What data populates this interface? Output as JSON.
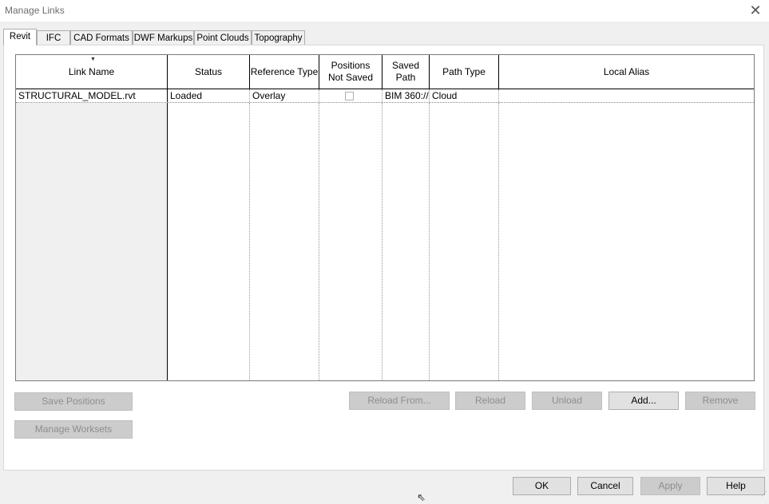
{
  "window": {
    "title": "Manage Links"
  },
  "tabs": [
    {
      "label": "Revit",
      "active": true
    },
    {
      "label": "IFC",
      "active": false
    },
    {
      "label": "CAD Formats",
      "active": false
    },
    {
      "label": "DWF Markups",
      "active": false
    },
    {
      "label": "Point Clouds",
      "active": false
    },
    {
      "label": "Topography",
      "active": false
    }
  ],
  "table": {
    "columns": [
      "Link Name",
      "Status",
      "Reference Type",
      "Positions Not Saved",
      "Saved Path",
      "Path Type",
      "Local Alias"
    ],
    "rows": [
      {
        "link_name": "STRUCTURAL_MODEL.rvt",
        "status": "Loaded",
        "reference_type": "Overlay",
        "positions_not_saved": false,
        "saved_path": "BIM 360://",
        "path_type": "Cloud",
        "local_alias": ""
      }
    ]
  },
  "buttons": {
    "save_positions": "Save Positions",
    "manage_worksets": "Manage Worksets",
    "reload_from": "Reload From...",
    "reload": "Reload",
    "unload": "Unload",
    "add": "Add...",
    "remove": "Remove",
    "ok": "OK",
    "cancel": "Cancel",
    "apply": "Apply",
    "help": "Help"
  },
  "icons": {
    "close": "close-icon",
    "sort": "sort-arrow-icon",
    "cursor": "mouse-cursor-icon",
    "resize": "resize-grip-icon"
  }
}
